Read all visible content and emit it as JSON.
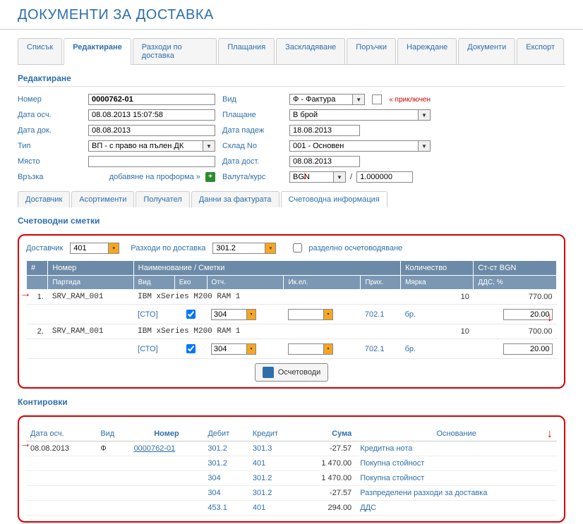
{
  "title": "ДОКУМЕНТИ ЗА ДОСТАВКА",
  "mainTabs": [
    "Списък",
    "Редактиране",
    "Разходи по доставка",
    "Плащания",
    "Заскладяване",
    "Поръчки",
    "Нареждане",
    "Документи",
    "Експорт"
  ],
  "activeMainTab": 1,
  "sectionTitle": "Редактиране",
  "form": {
    "labels": {
      "number": "Номер",
      "dateOsch": "Дата осч.",
      "dateDoc": "Дата док.",
      "type": "Тип",
      "place": "Място",
      "link": "Връзка",
      "kind": "Вид",
      "payment": "Плащане",
      "dateDue": "Дата падеж",
      "warehouse": "Склад No",
      "dateDeliv": "Дата дост.",
      "currency": "Валута/курс"
    },
    "number": "0000762-01",
    "dateOsch": "08.08.2013 15:07:58",
    "dateDoc": "08.08.2013",
    "type": "ВП - с право на пълен ДК",
    "place": "",
    "addProforma": "добавяне на проформа »",
    "kind": "Ф - Фактура",
    "payment": "В брой",
    "dateDue": "18.08.2013",
    "warehouse": "001 - Основен",
    "dateDeliv": "08.08.2013",
    "currency": "BGN",
    "rate": "1.000000",
    "closed": "« приключен"
  },
  "detailTabs": [
    "Доставчик",
    "Асортименти",
    "Получател",
    "Данни за фактурата",
    "Счетоводна информация"
  ],
  "activeDetailTab": 4,
  "accounts": {
    "title": "Счетоводни сметки",
    "supplierLabel": "Доставчик",
    "supplier": "401",
    "expenseLabel": "Разходи по доставка",
    "expense": "301.2",
    "splitLabel": "разделно осчетоводяване",
    "headers": {
      "row1": [
        "#",
        "Номер",
        "Наименование / Сметки",
        "",
        "",
        "",
        "",
        "Количество",
        "Ст-ст BGN"
      ],
      "row2": [
        "",
        "Партида",
        "Вид",
        "Еко",
        "Отч.",
        "Ик.ел.",
        "Прих.",
        "Мярка",
        "ДДС, %"
      ]
    },
    "rows": [
      {
        "n": "1.",
        "code": "SRV_RAM_001",
        "name": "IBM xSeries M200 RAM 1",
        "qty": "10",
        "amount": "770.00",
        "cto": "[СТО]",
        "eko": true,
        "otch": "304",
        "ikel": "",
        "prih": "702.1",
        "measure": "бр.",
        "vat": "20.00"
      },
      {
        "n": "2.",
        "code": "SRV_RAM_001",
        "name": "IBM xSeries M200 RAM 1",
        "qty": "10",
        "amount": "700.00",
        "cto": "[СТО]",
        "eko": true,
        "otch": "304",
        "ikel": "",
        "prih": "702.1",
        "measure": "бр.",
        "vat": "20.00"
      }
    ],
    "btn": "Осчетоводи"
  },
  "kont": {
    "title": "Контировки",
    "headers": [
      "Дата осч.",
      "Вид",
      "Номер",
      "Дебит",
      "Кредит",
      "Сума",
      "Основание"
    ],
    "rows": [
      {
        "date": "08.08.2013",
        "kind": "Ф",
        "num": "0000762-01",
        "debit": "301.2",
        "credit": "301.3",
        "sum": "-27.57",
        "reason": "Кредитна нота"
      },
      {
        "date": "",
        "kind": "",
        "num": "",
        "debit": "301.2",
        "credit": "401",
        "sum": "1 470.00",
        "reason": "Покупна стойност"
      },
      {
        "date": "",
        "kind": "",
        "num": "",
        "debit": "304",
        "credit": "301.2",
        "sum": "1 470.00",
        "reason": "Покупна стойност"
      },
      {
        "date": "",
        "kind": "",
        "num": "",
        "debit": "304",
        "credit": "301.2",
        "sum": "-27.57",
        "reason": "Разпределени разходи за доставка"
      },
      {
        "date": "",
        "kind": "",
        "num": "",
        "debit": "453.1",
        "credit": "401",
        "sum": "294.00",
        "reason": "ДДС"
      }
    ]
  }
}
